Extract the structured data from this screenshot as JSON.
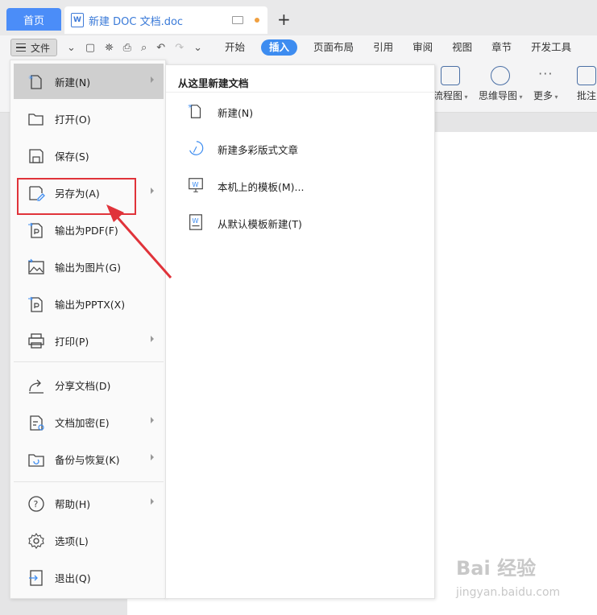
{
  "tabs": {
    "home": "首页",
    "doc_title": "新建 DOC 文档.doc",
    "doc_icon_letter": "W",
    "new_tab": "+"
  },
  "toolbar": {
    "file_label": "文件",
    "ribbon_tabs": [
      "开始",
      "插入",
      "页面布局",
      "引用",
      "审阅",
      "视图",
      "章节",
      "开发工具"
    ],
    "active_tab": "插入"
  },
  "ribbon": {
    "items": [
      {
        "label": "流程图",
        "icon": "flowchart-icon"
      },
      {
        "label": "思维导图",
        "icon": "mindmap-icon"
      },
      {
        "label": "更多",
        "icon": "more-icon"
      },
      {
        "label": "批注",
        "icon": "comment-icon"
      }
    ]
  },
  "file_menu": {
    "items": [
      {
        "label": "新建(N)",
        "icon": "new-doc-icon",
        "submenu": true,
        "selected": true
      },
      {
        "label": "打开(O)",
        "icon": "folder-icon",
        "submenu": false
      },
      {
        "label": "保存(S)",
        "icon": "save-icon",
        "submenu": false
      },
      {
        "label": "另存为(A)",
        "icon": "save-as-icon",
        "submenu": true
      },
      {
        "label": "输出为PDF(F)",
        "icon": "pdf-icon",
        "submenu": false
      },
      {
        "label": "输出为图片(G)",
        "icon": "image-icon",
        "submenu": false
      },
      {
        "label": "输出为PPTX(X)",
        "icon": "pptx-icon",
        "submenu": false
      },
      {
        "label": "打印(P)",
        "icon": "print-icon",
        "submenu": true
      },
      {
        "label": "分享文档(D)",
        "icon": "share-icon",
        "submenu": false
      },
      {
        "label": "文档加密(E)",
        "icon": "encrypt-icon",
        "submenu": true
      },
      {
        "label": "备份与恢复(K)",
        "icon": "backup-icon",
        "submenu": true
      },
      {
        "label": "帮助(H)",
        "icon": "help-icon",
        "submenu": true
      },
      {
        "label": "选项(L)",
        "icon": "gear-icon",
        "submenu": false
      },
      {
        "label": "退出(Q)",
        "icon": "exit-icon",
        "submenu": false
      }
    ]
  },
  "submenu": {
    "title": "从这里新建文档",
    "items": [
      {
        "label": "新建(N)",
        "icon": "new-doc-icon"
      },
      {
        "label": "新建多彩版式文章",
        "icon": "colorful-article-icon"
      },
      {
        "label": "本机上的模板(M)...",
        "icon": "local-template-icon"
      },
      {
        "label": "从默认模板新建(T)",
        "icon": "default-template-icon"
      }
    ]
  },
  "annotation": {
    "color": "#e0333a",
    "target": "另存为(A)"
  },
  "watermark": {
    "main": "Bai 经验",
    "sub": "jingyan.baidu.com"
  },
  "colors": {
    "accent": "#3d8cf0",
    "home_tab": "#4b8df8",
    "selected_item": "#cfcfcf"
  }
}
